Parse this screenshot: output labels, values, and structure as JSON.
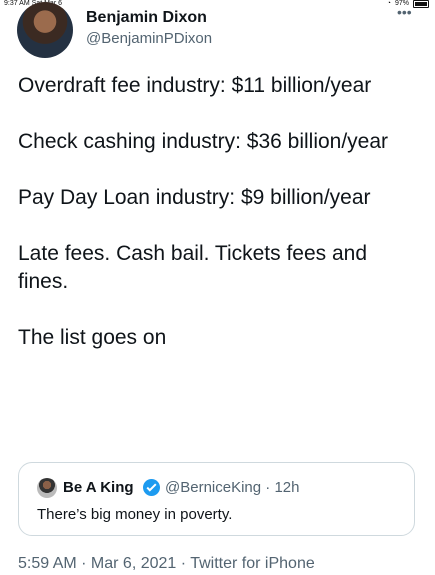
{
  "status_bar": {
    "time": "9:37 AM",
    "date": "Sat Mar 6",
    "battery": "97%",
    "battery_level": 0.97
  },
  "tweet": {
    "author_name": "Benjamin Dixon",
    "author_handle": "@BenjaminPDixon",
    "body": [
      "Overdraft fee industry: $11 billion/year",
      "Check cashing industry: $36 billion/year",
      "Pay Day Loan industry: $9 billion/year",
      "Late fees. Cash bail. Tickets fees and fines.",
      "The list goes on"
    ],
    "timestamp": "5:59 AM · Mar 6, 2021 · Twitter for iPhone"
  },
  "quote": {
    "author_name": "Be A King",
    "author_handle_time": "@BerniceKing · 12h",
    "text": "There’s big money in poverty."
  },
  "colors": {
    "text": "#0f1419",
    "secondary": "#536471",
    "verified": "#1d9bf0",
    "border": "#cfd9de"
  },
  "icons": {
    "more": "more-icon",
    "verified": "verified-icon",
    "wifi": "wifi-icon",
    "battery": "battery-icon"
  }
}
